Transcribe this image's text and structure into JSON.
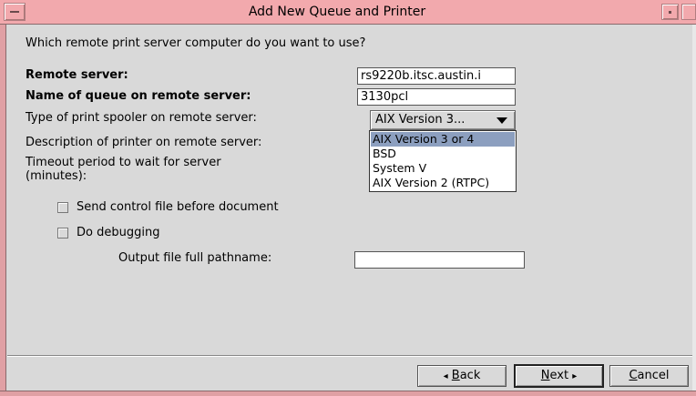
{
  "window": {
    "title": "Add New Queue and Printer"
  },
  "prompt": "Which remote print server computer do you want to use?",
  "form": {
    "remote_server_label": "Remote server:",
    "remote_server_value": "rs9220b.itsc.austin.i",
    "queue_name_label": "Name of queue on remote server:",
    "queue_name_value": "3130pcl",
    "spooler_label": "Type of print spooler on remote server:",
    "spooler_selected": "AIX Version 3...",
    "spooler_options": [
      "AIX Version 3 or 4",
      "BSD",
      "System V",
      "AIX Version 2 (RTPC)"
    ],
    "description_label": "Description of printer on remote server:",
    "timeout_label_line1": "Timeout period to wait for server",
    "timeout_label_line2": "(minutes):",
    "send_control_label": "Send control file before document",
    "debugging_label": "Do debugging",
    "output_file_label": "Output file full pathname:",
    "output_file_value": ""
  },
  "buttons": {
    "back_arrow": "◂",
    "back_mnemonic": "B",
    "back_rest": "ack",
    "next_mnemonic": "N",
    "next_rest": "ext",
    "next_arrow": "▸",
    "cancel_mnemonic": "C",
    "cancel_rest": "ancel"
  }
}
